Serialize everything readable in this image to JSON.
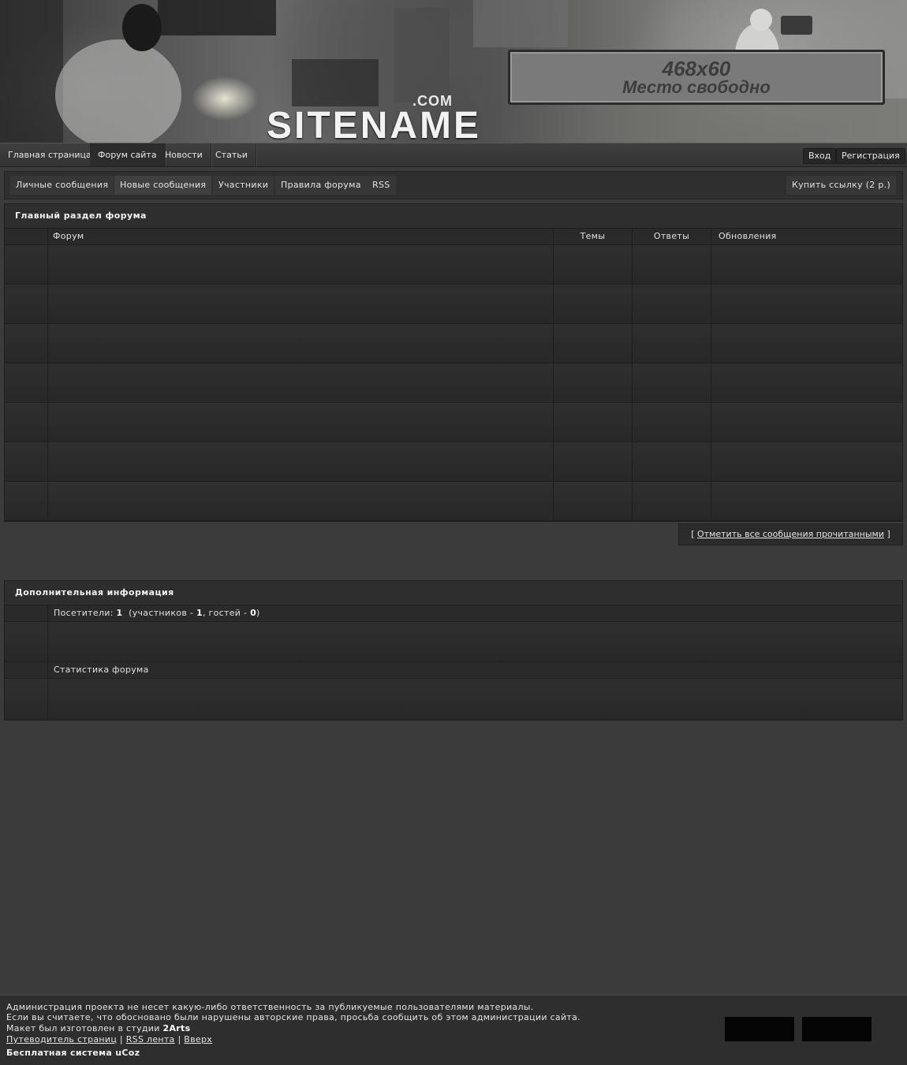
{
  "header": {
    "logo_com": ".COM",
    "logo_name": "SITENAME",
    "banner_size": "468x60",
    "banner_text": "Место свободно"
  },
  "topnav": {
    "items": [
      "Главная страница",
      "Форум сайта",
      "Новости",
      "Статьи"
    ],
    "login": "Вход",
    "register": "Регистрация"
  },
  "forumnav": {
    "items": [
      "Личные сообщения",
      "Новые сообщения",
      "Участники",
      "Правила форума",
      "RSS"
    ],
    "buy_link": "Купить ссылку (2 р.)"
  },
  "main_section": {
    "title": "Главный раздел форума",
    "columns": [
      "Форум",
      "Темы",
      "Ответы",
      "Обновления"
    ]
  },
  "mark_read": {
    "open": "[",
    "link": "Отметить все сообщения прочитанными",
    "close": "]"
  },
  "info_section": {
    "title": "Дополнительная информация",
    "visitors_label": "Посетители:",
    "visitors_total": "1",
    "members_prefix": "(участников -",
    "members_count": "1",
    "guests_prefix": ", гостей -",
    "guests_count": "0",
    "close_paren": ")",
    "stats_label": "Статистика форума"
  },
  "footer": {
    "line1": "Администрация проекта не несет какую-либо ответственность за публикуемые пользователями материалы.",
    "line2": "Если вы считаете, что обосновано были нарушены авторские права, просьба сообщить об этом администрации сайта.",
    "line3_prefix": "Макет был изготовлен в студии",
    "studio": "2Arts",
    "links": [
      "Путеводитель страниц",
      "RSS лента",
      "Вверх"
    ],
    "separator": "|",
    "ucoz": "Бесплатная система uCoz"
  }
}
